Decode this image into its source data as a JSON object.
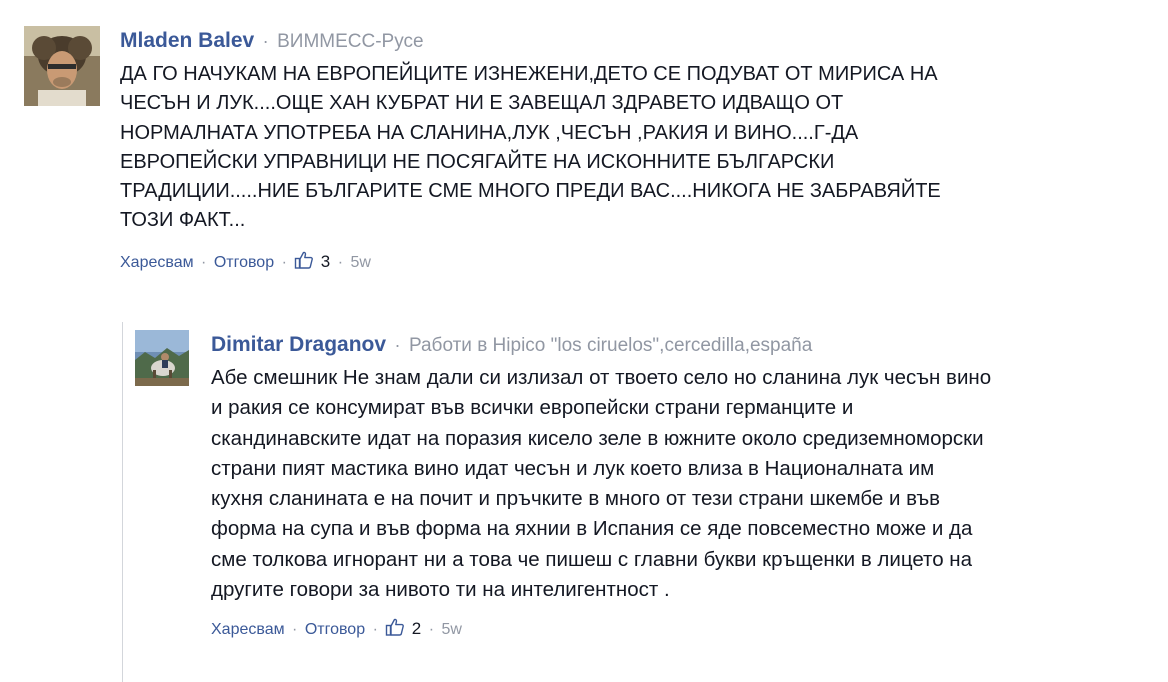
{
  "comments": [
    {
      "author": "Mladen Balev",
      "separator": "·",
      "meta": "ВИММЕСС-Русе",
      "avatar_icon": "user-photo-icon",
      "text": "ДА ГО НАЧУКАМ НА ЕВРОПЕЙЦИТЕ ИЗНЕЖЕНИ,ДЕТО СЕ ПОДУВАТ ОТ МИРИСА НА\nЧЕСЪН И ЛУК....ОЩЕ ХАН КУБРАТ НИ Е ЗАВЕЩАЛ ЗДРАВЕТО ИДВАЩО ОТ\nНОРМАЛНАТА УПОТРЕБА НА СЛАНИНА,ЛУК ,ЧЕСЪН ,РАКИЯ И ВИНО....Г-ДА\nЕВРОПЕЙСКИ УПРАВНИЦИ НЕ ПОСЯГАЙТЕ НА ИСКОННИТЕ БЪЛГАРСКИ\nТРАДИЦИИ.....НИЕ БЪЛГАРИТЕ СМЕ МНОГО ПРЕДИ ВАС....НИКОГА НЕ ЗАБРАВЯЙТЕ\nТОЗИ ФАКТ...",
      "actions": {
        "like": "Харесвам",
        "reply": "Отговор",
        "dot": "·",
        "like_count": "3",
        "time": "5w",
        "like_icon": "thumbs-up-icon"
      }
    },
    {
      "author": "Dimitar Draganov",
      "separator": "·",
      "meta": "Работи в Hipico \"los ciruelos\",cercedilla,españa",
      "avatar_icon": "user-photo-icon",
      "text": "Абе смешник Не знам дали си излизал от твоето село но сланина лук чесън вино\nи ракия се консумират във всички европейски страни германците и\nскандинавските идат на поразия кисело зеле в южните около средиземноморски\nстрани пият мастика вино идат чесън и лук което влиза в Националната им\nкухня сланината е на почит и пръчките в много от тези страни шкембе и във\nформа на супа и във форма на яхнии в Испания се яде повсеместно може и да\nсме толкова игнорант ни а това че пишеш с главни букви кръщенки в лицето на\nдругите говори за нивото ти на интелигентност .",
      "actions": {
        "like": "Харесвам",
        "reply": "Отговор",
        "dot": "·",
        "like_count": "2",
        "time": "5w",
        "like_icon": "thumbs-up-icon"
      }
    }
  ],
  "colors": {
    "author": "#3b5998",
    "meta": "#9197a3",
    "text": "#141823",
    "thread_line": "#d3d6db"
  }
}
